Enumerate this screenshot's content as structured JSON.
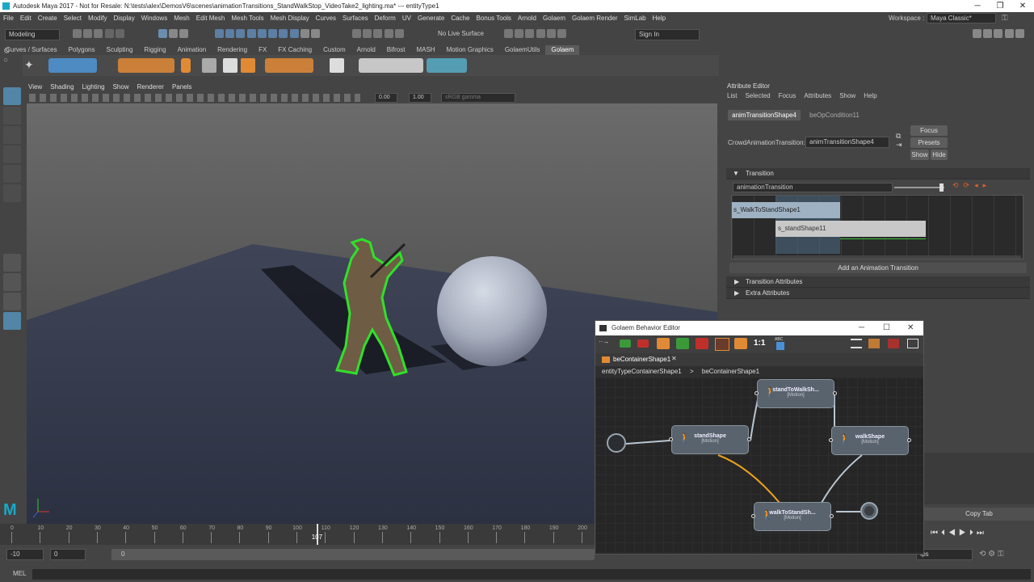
{
  "window": {
    "title": "Autodesk Maya 2017 - Not for Resale: N:\\tests\\alex\\DemosV6\\scenes\\animationTransitions_StandWalkStop_VideoTake2_lighting.ma*  ---  entityType1",
    "minimize": "─",
    "maximize": "❐",
    "close": "✕"
  },
  "menubar": {
    "items": [
      "File",
      "Edit",
      "Create",
      "Select",
      "Modify",
      "Display",
      "Windows",
      "Mesh",
      "Edit Mesh",
      "Mesh Tools",
      "Mesh Display",
      "Curves",
      "Surfaces",
      "Deform",
      "UV",
      "Generate",
      "Cache",
      "Bonus Tools",
      "Arnold",
      "Golaem",
      "Golaem Render",
      "SimLab",
      "Help"
    ],
    "workspace_label": "Workspace :",
    "workspace_value": "Maya Classic*"
  },
  "statusline": {
    "mode": "Modeling",
    "live_surface": "No Live Surface",
    "sign_in": "Sign In"
  },
  "shelf": {
    "tabs": [
      "Curves / Surfaces",
      "Polygons",
      "Sculpting",
      "Rigging",
      "Animation",
      "Rendering",
      "FX",
      "FX Caching",
      "Custom",
      "Arnold",
      "Bifrost",
      "MASH",
      "Motion Graphics",
      "GolaemUtils",
      "Golaem"
    ],
    "active": "Golaem"
  },
  "panel": {
    "menu": [
      "View",
      "Shading",
      "Lighting",
      "Show",
      "Renderer",
      "Panels"
    ],
    "exposure": "0.00",
    "gamma": "1.00",
    "colorspace": "sRGB gamma"
  },
  "timeslider": {
    "ticks": [
      "0",
      "10",
      "20",
      "30",
      "40",
      "50",
      "60",
      "70",
      "80",
      "90",
      "100",
      "110",
      "120",
      "130",
      "140",
      "150",
      "160",
      "170",
      "180",
      "190",
      "200"
    ],
    "current_frame": "107",
    "current_fraction": 0.535
  },
  "range": {
    "start": "-10",
    "anim_start": "0",
    "range_start": "0",
    "fps": "fps"
  },
  "cmdline": {
    "label": "MEL"
  },
  "attribute_editor": {
    "title": "Attribute Editor",
    "menu": [
      "List",
      "Selected",
      "Focus",
      "Attributes",
      "Show",
      "Help"
    ],
    "tabs": [
      "animTransitionShape4",
      "beOpCondition11"
    ],
    "field_label": "CrowdAnimationTransition:",
    "field_value": "animTransitionShape4",
    "focus": "Focus",
    "presets": "Presets",
    "show": "Show",
    "hide": "Hide",
    "section_transition": "Transition",
    "transition_name": "animationTransition",
    "clip1": "s_WalkToStandShape1",
    "clip2": "s_standShape11",
    "add_transition": "Add an Animation Transition",
    "section_transition_attrs": "Transition Attributes",
    "section_extra": "Extra Attributes",
    "copy_tab": "Copy Tab"
  },
  "behavior_editor": {
    "title": "Golaem Behavior Editor",
    "ratio": "1:1",
    "abc": "ABC",
    "tab": "beContainerShape1",
    "path1": "entityTypeContainerShape1",
    "path_sep": ">",
    "path2": "beContainerShape1",
    "nodes": [
      {
        "name": "standToWalkSh...",
        "sub": "[Motion]"
      },
      {
        "name": "standShape",
        "sub": "[Motion]"
      },
      {
        "name": "walkShape",
        "sub": "[Motion]"
      },
      {
        "name": "walkToStandSh...",
        "sub": "[Motion]"
      }
    ],
    "colors": {
      "orange": "#e8a020",
      "link": "#b8c6d2"
    }
  }
}
